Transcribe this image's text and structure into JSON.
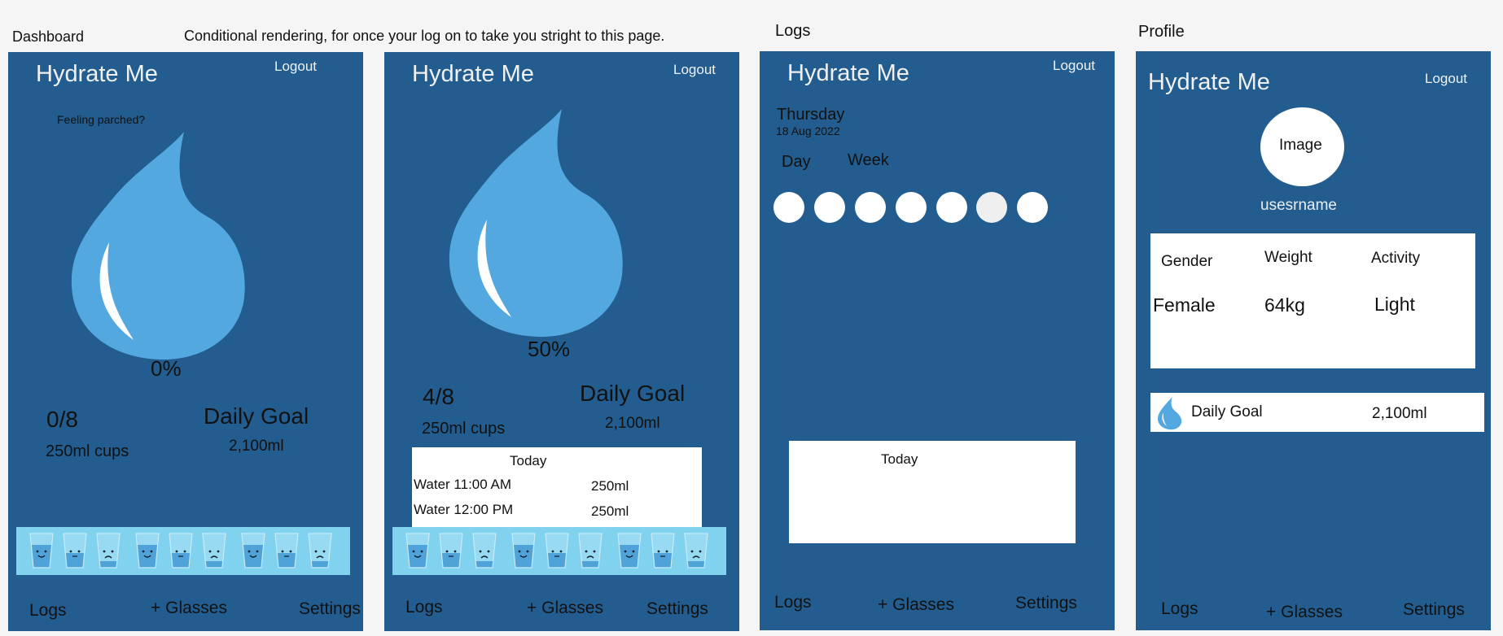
{
  "captions": {
    "dashboard": "Dashboard",
    "note": "Conditional rendering, for once your log on to take you stright to this page.",
    "logs": "Logs",
    "profile": "Profile"
  },
  "app_title": "Hydrate Me",
  "logout_label": "Logout",
  "nav": {
    "logs": "Logs",
    "plus": "+",
    "glasses": "Glasses",
    "settings": "Settings"
  },
  "colors": {
    "panel": "#235d8f",
    "drop": "#53a9df",
    "strip": "#80d2ee"
  },
  "dashboard": {
    "prompt": "Feeling parched?",
    "percent": "0%",
    "count": "0/8",
    "cups": "250ml cups",
    "goal_label": "Daily Goal",
    "goal_value": "2,100ml",
    "progress": 0
  },
  "dashboard2": {
    "percent": "50%",
    "count": "4/8",
    "cups": "250ml cups",
    "goal_label": "Daily Goal",
    "goal_value": "2,100ml",
    "progress": 0.5,
    "today_title": "Today",
    "entries": [
      {
        "label": "Water 11:00 AM",
        "amount": "250ml"
      },
      {
        "label": "Water 12:00 PM",
        "amount": "250ml"
      }
    ]
  },
  "logs": {
    "day_name": "Thursday",
    "date": "18 Aug 2022",
    "tab_day": "Day",
    "tab_week": "Week",
    "today_title": "Today"
  },
  "profile": {
    "image_label": "Image",
    "username": "usesrname",
    "gender_label": "Gender",
    "weight_label": "Weight",
    "activity_label": "Activity",
    "gender_value": "Female",
    "weight_value": "64kg",
    "activity_value": "Light",
    "goal_label": "Daily Goal",
    "goal_value": "2,100ml"
  }
}
